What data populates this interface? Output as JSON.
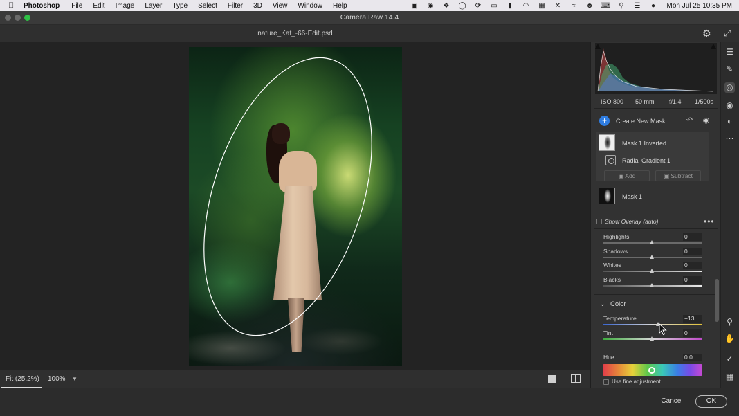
{
  "menubar": {
    "items": [
      "Photoshop",
      "File",
      "Edit",
      "Image",
      "Layer",
      "Type",
      "Select",
      "Filter",
      "3D",
      "View",
      "Window",
      "Help"
    ],
    "clock": "Mon Jul 25  10:35 PM"
  },
  "window": {
    "title": "Camera Raw 14.4"
  },
  "document": {
    "filename": "nature_Kat_-66-Edit.psd"
  },
  "bottom_bar": {
    "zoom_fit": "Fit (25.2%)",
    "zoom_100": "100%"
  },
  "footer": {
    "cancel": "Cancel",
    "ok": "OK"
  },
  "exif": {
    "iso": "ISO 800",
    "focal": "50 mm",
    "aperture": "f/1.4",
    "shutter": "1/500s"
  },
  "masking": {
    "create_new": "Create New Mask",
    "mask1_inverted": "Mask 1 Inverted",
    "radial_gradient": "Radial Gradient 1",
    "add": "Add",
    "subtract": "Subtract",
    "mask1": "Mask 1",
    "show_overlay": "Show Overlay (auto)"
  },
  "adjustments": {
    "highlights": {
      "label": "Highlights",
      "value": "0"
    },
    "shadows": {
      "label": "Shadows",
      "value": "0"
    },
    "whites": {
      "label": "Whites",
      "value": "0"
    },
    "blacks": {
      "label": "Blacks",
      "value": "0"
    }
  },
  "color": {
    "title": "Color",
    "temperature": {
      "label": "Temperature",
      "value": "+13"
    },
    "tint": {
      "label": "Tint",
      "value": "0"
    },
    "hue": {
      "label": "Hue",
      "value": "0.0"
    },
    "fine_adjustment": "Use fine adjustment"
  }
}
